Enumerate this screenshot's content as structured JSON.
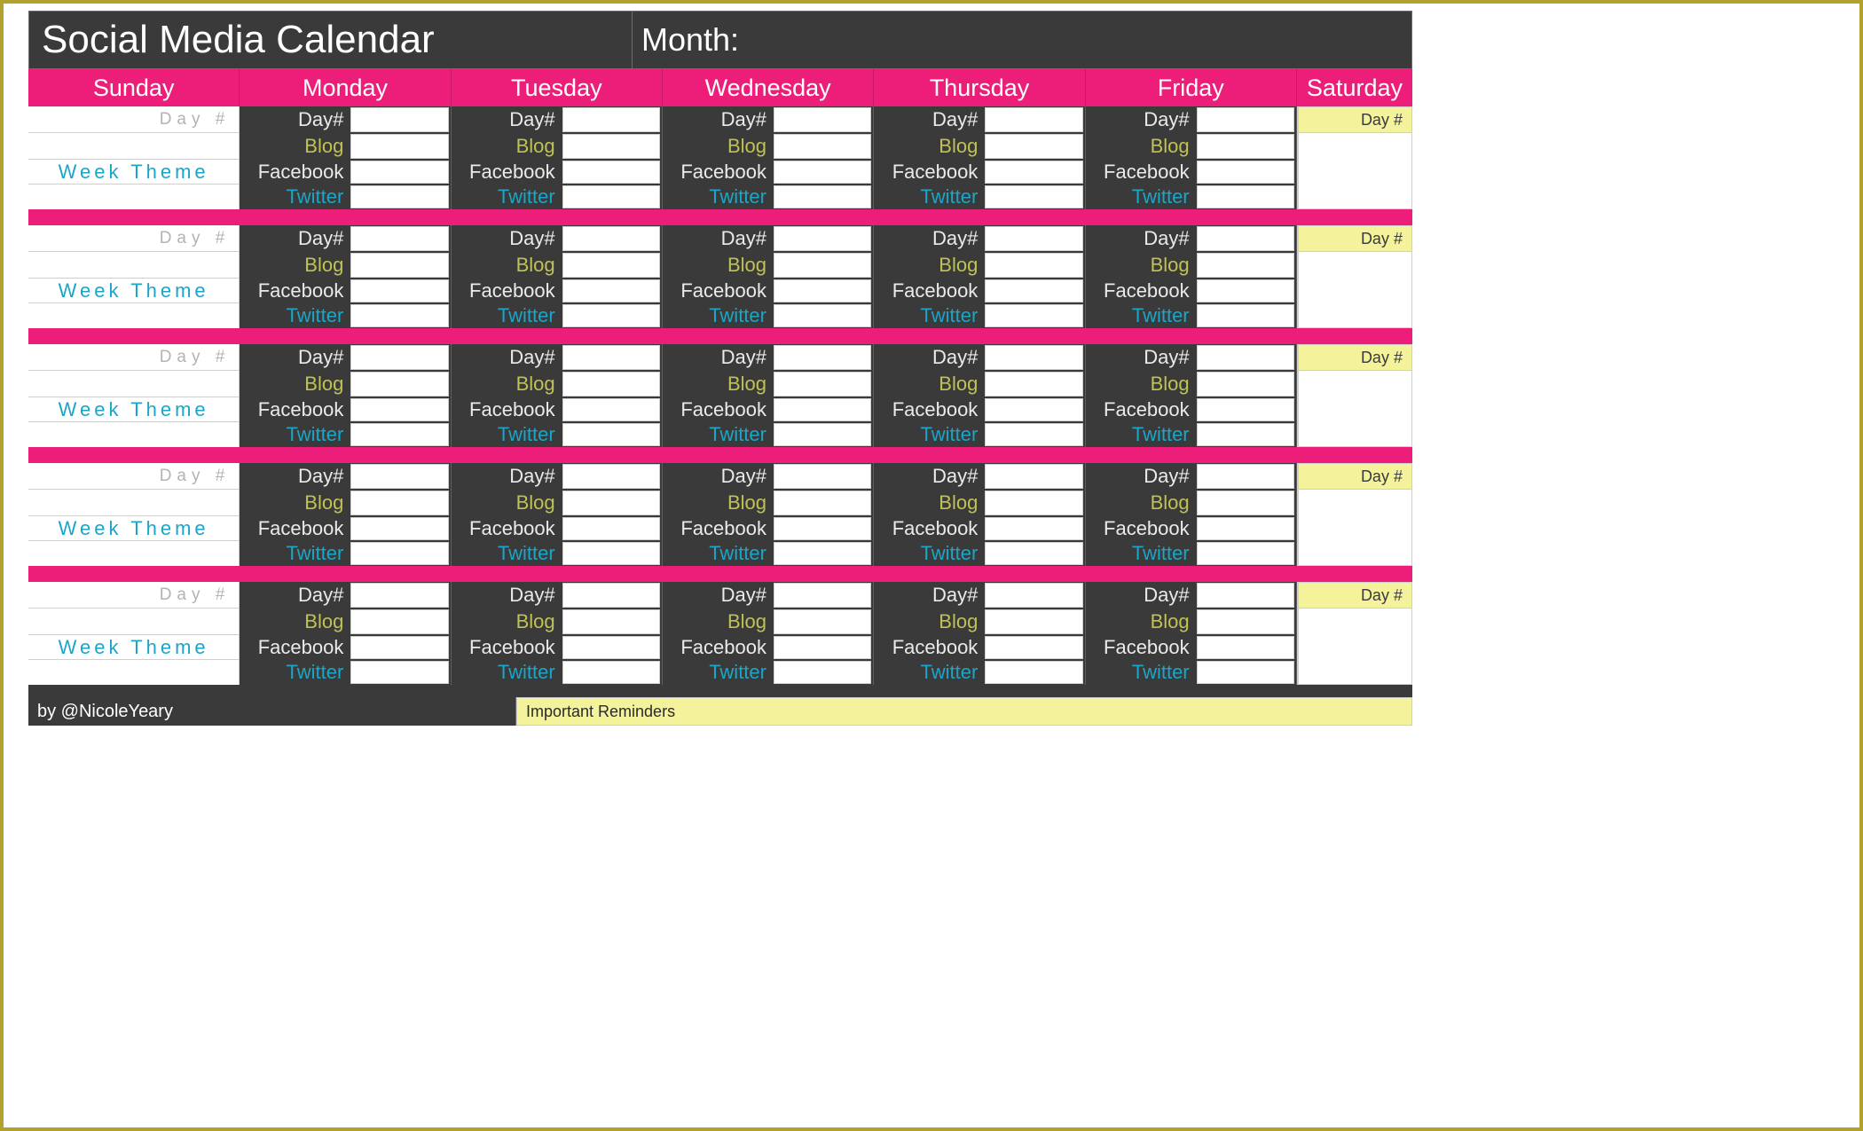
{
  "header": {
    "title": "Social Media Calendar",
    "month_label": "Month:"
  },
  "days": {
    "sunday": "Sunday",
    "monday": "Monday",
    "tuesday": "Tuesday",
    "wednesday": "Wednesday",
    "thursday": "Thursday",
    "friday": "Friday",
    "saturday": "Saturday"
  },
  "sunday_labels": {
    "day": "Day #",
    "theme": "Week Theme"
  },
  "weekday_labels": {
    "day": "Day#",
    "blog": "Blog",
    "facebook": "Facebook",
    "twitter": "Twitter"
  },
  "saturday_labels": {
    "day": "Day #"
  },
  "footer": {
    "byline": "by @NicoleYeary",
    "reminders": "Important Reminders"
  }
}
